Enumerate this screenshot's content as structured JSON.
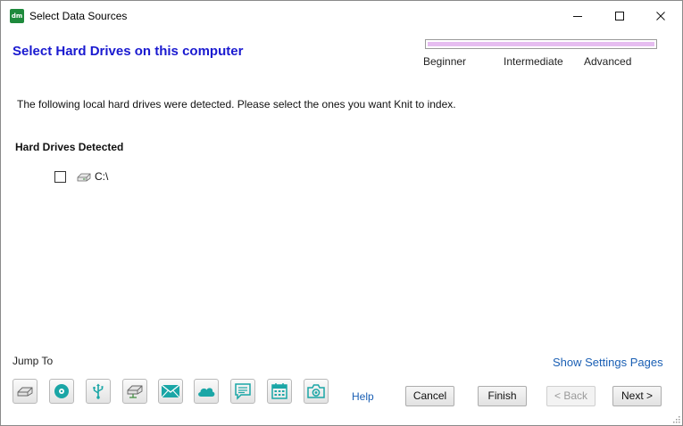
{
  "window": {
    "app_icon_text": "dm",
    "title": "Select Data Sources"
  },
  "header": {
    "page_title": "Select Hard Drives on this computer",
    "progress_fraction": 1.0,
    "levels": [
      "Beginner",
      "Intermediate",
      "Advanced"
    ]
  },
  "main": {
    "description": "The following local hard drives were detected. Please select the ones you want Knit to index.",
    "section_title": "Hard Drives Detected",
    "drives": [
      {
        "label": "C:\\",
        "checked": false
      }
    ]
  },
  "footer": {
    "jump_to_label": "Jump To",
    "show_settings_label": "Show Settings Pages",
    "help_label": "Help",
    "jump_icons": [
      "hard-drive-icon",
      "disc-icon",
      "usb-icon",
      "network-drive-icon",
      "email-icon",
      "cloud-icon",
      "chat-icon",
      "calendar-icon",
      "camera-icon"
    ],
    "buttons": {
      "cancel": "Cancel",
      "finish": "Finish",
      "back": "< Back",
      "next": "Next >"
    }
  },
  "colors": {
    "title_blue": "#1a1ad0",
    "link_blue": "#1a5fb4",
    "progress_fill": "#e6bdf0",
    "icon_teal": "#1aa6a6",
    "app_icon_green": "#1e8a3c"
  }
}
